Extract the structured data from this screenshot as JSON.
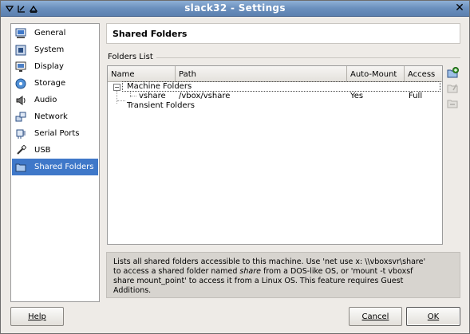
{
  "window": {
    "title": "slack32 - Settings"
  },
  "titlebar_icons": [
    "menu-down-icon",
    "pin-icon",
    "shade-icon"
  ],
  "sidebar": {
    "items": [
      {
        "label": "General",
        "icon": "general-icon"
      },
      {
        "label": "System",
        "icon": "system-icon"
      },
      {
        "label": "Display",
        "icon": "display-icon"
      },
      {
        "label": "Storage",
        "icon": "storage-icon"
      },
      {
        "label": "Audio",
        "icon": "audio-icon"
      },
      {
        "label": "Network",
        "icon": "network-icon"
      },
      {
        "label": "Serial Ports",
        "icon": "serial-port-icon"
      },
      {
        "label": "USB",
        "icon": "usb-icon"
      },
      {
        "label": "Shared Folders",
        "icon": "shared-folder-icon",
        "selected": true
      }
    ]
  },
  "page": {
    "title": "Shared Folders",
    "list_label": "Folders List"
  },
  "table": {
    "columns": [
      "Name",
      "Path",
      "Auto-Mount",
      "Access"
    ],
    "groups": [
      {
        "label": "Machine Folders",
        "expanded": true,
        "rows": [
          {
            "name": "vshare",
            "path": "/vbox/vshare",
            "auto_mount": "Yes",
            "access": "Full"
          }
        ]
      },
      {
        "label": "Transient Folders",
        "rows": []
      }
    ]
  },
  "side_toolbar": [
    "add-folder-icon",
    "edit-folder-icon",
    "remove-folder-icon"
  ],
  "info": {
    "line1": "Lists all shared folders accessible to this machine. Use 'net use x: \\\\vboxsvr\\share'",
    "line2_pre": "to access a shared folder named ",
    "line2_em": "share",
    "line2_post": " from a DOS-like OS, or 'mount -t vboxsf",
    "line3": "share mount_point' to access it from a Linux OS. This feature requires Guest",
    "line4": "Additions."
  },
  "buttons": {
    "help": "Help",
    "cancel": "Cancel",
    "ok": "OK"
  },
  "colors": {
    "titlebar": "#6a8fbd",
    "selection": "#3f78c9",
    "add_icon": "#3a9a2e"
  }
}
